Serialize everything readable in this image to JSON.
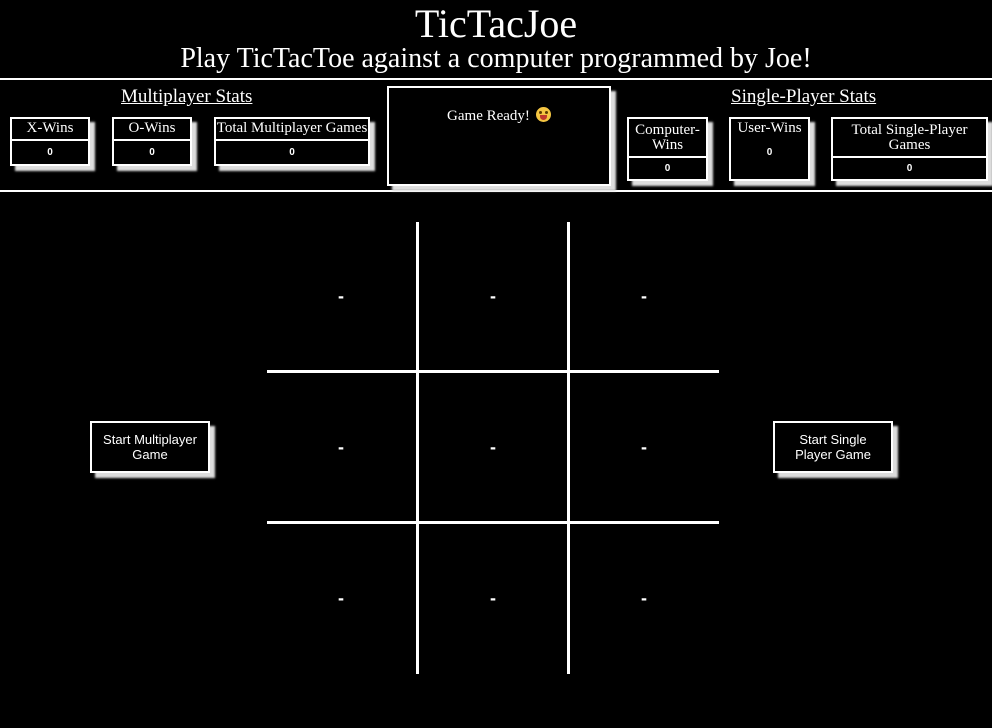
{
  "header": {
    "title": "TicTacJoe",
    "subtitle": "Play TicTacToe against a computer programmed by Joe!"
  },
  "multiplayer_stats": {
    "heading": "Multiplayer Stats",
    "items": [
      {
        "label": "X-Wins",
        "value": "0"
      },
      {
        "label": "O-Wins",
        "value": "0"
      },
      {
        "label": "Total Multiplayer Games",
        "value": "0"
      }
    ]
  },
  "status": {
    "text": "Game Ready!",
    "emoji_icon": "grinning-face-with-tongue-icon"
  },
  "single_player_stats": {
    "heading": "Single-Player Stats",
    "items": [
      {
        "label": "Computer-Wins",
        "value": "0"
      },
      {
        "label": "User-Wins",
        "value": "0"
      },
      {
        "label": "Total Single-Player Games",
        "value": "0"
      }
    ]
  },
  "board": {
    "cells": [
      "-",
      "-",
      "-",
      "-",
      "-",
      "-",
      "-",
      "-",
      "-"
    ]
  },
  "buttons": {
    "start_multiplayer": "Start Multiplayer Game",
    "start_single": "Start Single Player Game"
  },
  "colors": {
    "background": "#000000",
    "foreground": "#ffffff",
    "shadow": "#dddddd"
  }
}
